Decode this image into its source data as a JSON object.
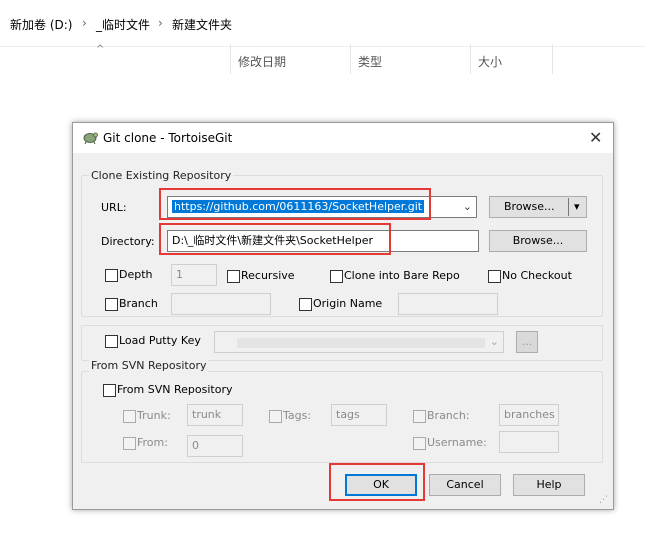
{
  "explorer": {
    "breadcrumb": [
      "新加卷 (D:)",
      "_临时文件",
      "新建文件夹"
    ],
    "columns": [
      "修改日期",
      "类型",
      "大小"
    ]
  },
  "dialog": {
    "title": "Git clone - TortoiseGit",
    "clone_group": "Clone Existing Repository",
    "url_label": "URL:",
    "url_value": "https://github.com/0611163/SocketHelper.git",
    "browse_url": "Browse...",
    "directory_label": "Directory:",
    "directory_value": "D:\\_临时文件\\新建文件夹\\SocketHelper",
    "browse_dir": "Browse...",
    "depth_label": "Depth",
    "depth_value": "1",
    "recursive_label": "Recursive",
    "bare_label": "Clone into Bare Repo",
    "nocheckout_label": "No Checkout",
    "branch_label": "Branch",
    "origin_label": "Origin Name",
    "putty_label": "Load Putty Key",
    "putty_browse": "...",
    "svn_group": "From SVN Repository",
    "svn_check_label": "From SVN Repository",
    "trunk_label": "Trunk:",
    "trunk_value": "trunk",
    "tags_label": "Tags:",
    "tags_value": "tags",
    "branch_svn_label": "Branch:",
    "branches_value": "branches",
    "from_label": "From:",
    "from_value": "0",
    "username_label": "Username:",
    "ok": "OK",
    "cancel": "Cancel",
    "help": "Help"
  },
  "colors": {
    "highlight": "#e53935",
    "selection": "#0078d7"
  }
}
